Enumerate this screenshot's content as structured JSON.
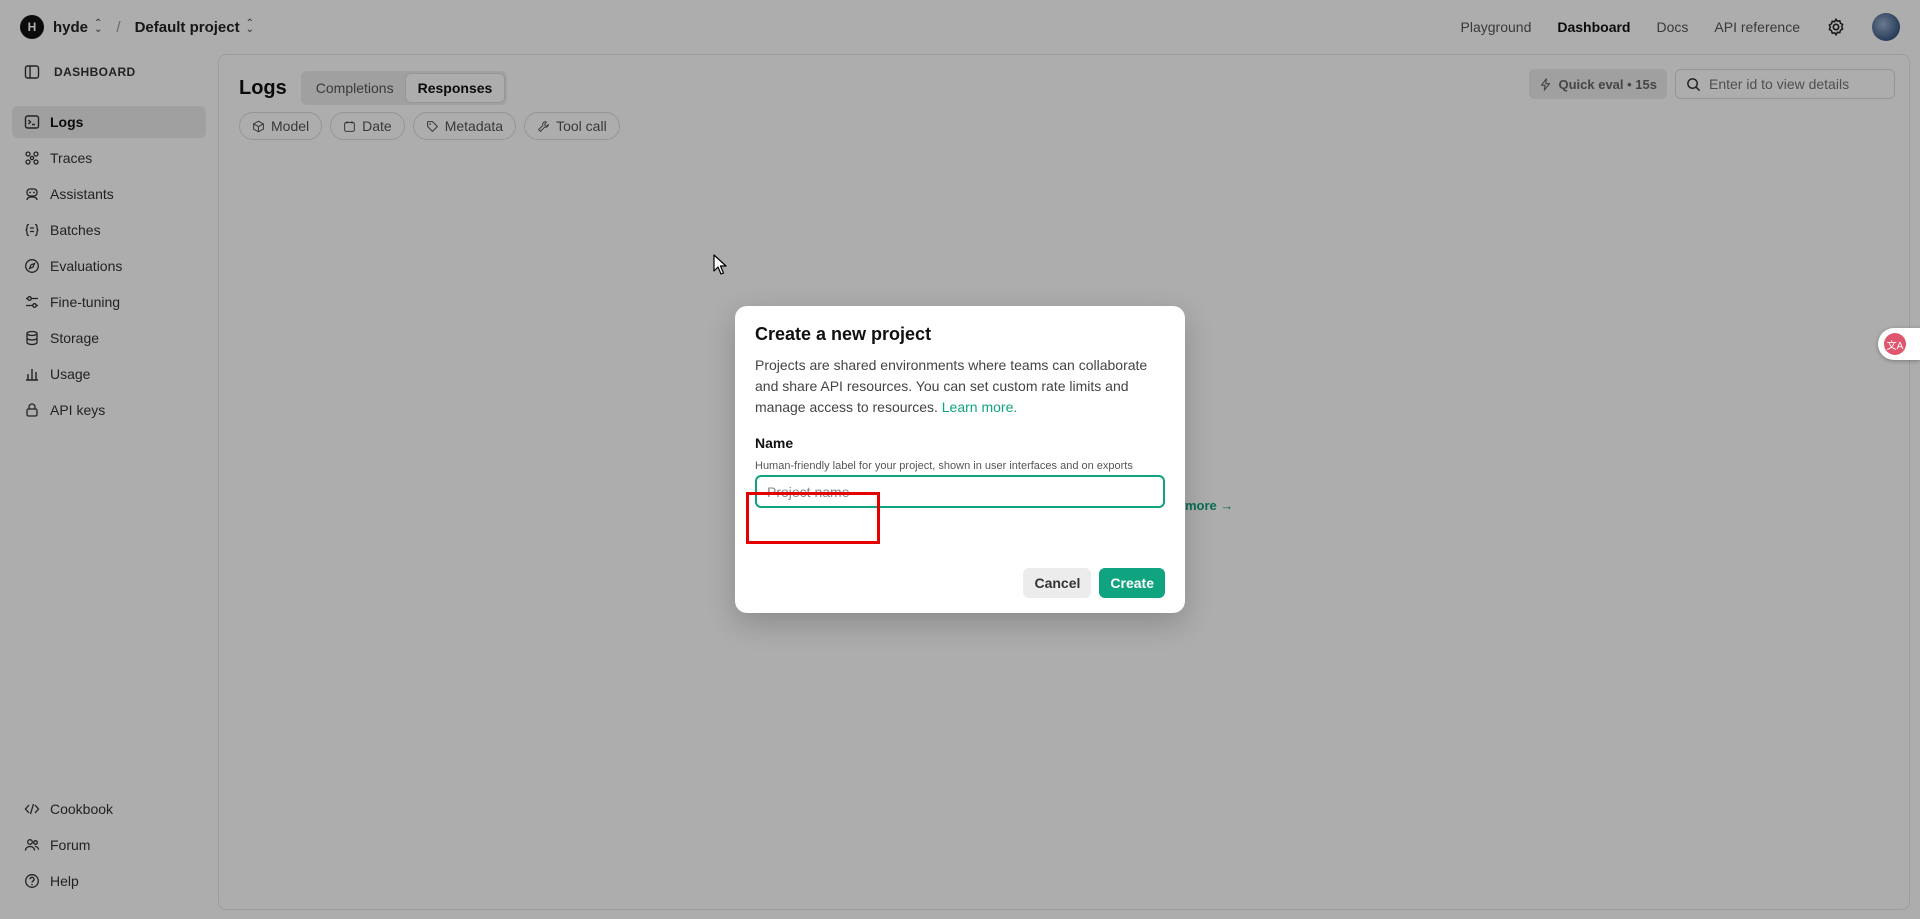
{
  "topbar": {
    "org_initial": "H",
    "org_name": "hyde",
    "separator": "/",
    "project_name": "Default project",
    "nav": [
      "Playground",
      "Dashboard",
      "Docs",
      "API reference"
    ],
    "active_nav": "Dashboard"
  },
  "sidebar": {
    "header": "DASHBOARD",
    "items": [
      {
        "label": "Logs",
        "icon": "terminal-icon"
      },
      {
        "label": "Traces",
        "icon": "traces-icon"
      },
      {
        "label": "Assistants",
        "icon": "robot-icon"
      },
      {
        "label": "Batches",
        "icon": "braces-icon"
      },
      {
        "label": "Evaluations",
        "icon": "compass-icon"
      },
      {
        "label": "Fine-tuning",
        "icon": "sliders-icon"
      },
      {
        "label": "Storage",
        "icon": "database-icon"
      },
      {
        "label": "Usage",
        "icon": "bar-chart-icon"
      },
      {
        "label": "API keys",
        "icon": "lock-icon"
      }
    ],
    "bottom_items": [
      {
        "label": "Cookbook",
        "icon": "code-icon"
      },
      {
        "label": "Forum",
        "icon": "users-icon"
      },
      {
        "label": "Help",
        "icon": "help-icon"
      }
    ]
  },
  "main": {
    "title": "Logs",
    "tabs": [
      "Completions",
      "Responses"
    ],
    "selected_tab": "Responses",
    "quick_eval": "Quick eval • 15s",
    "search_placeholder": "Enter id to view details",
    "filters": [
      "Model",
      "Date",
      "Metadata",
      "Tool call"
    ],
    "learn_more_partial": "more →"
  },
  "modal": {
    "title": "Create a new project",
    "description": "Projects are shared environments where teams can collaborate and share API resources. You can set custom rate limits and manage access to resources.",
    "learn_more": "Learn more.",
    "name_label": "Name",
    "name_hint": "Human-friendly label for your project, shown in user interfaces and on exports",
    "name_placeholder": "Project name",
    "name_value": "",
    "cancel_label": "Cancel",
    "create_label": "Create"
  },
  "colors": {
    "accent": "#10a37f",
    "highlight": "#e50000"
  }
}
